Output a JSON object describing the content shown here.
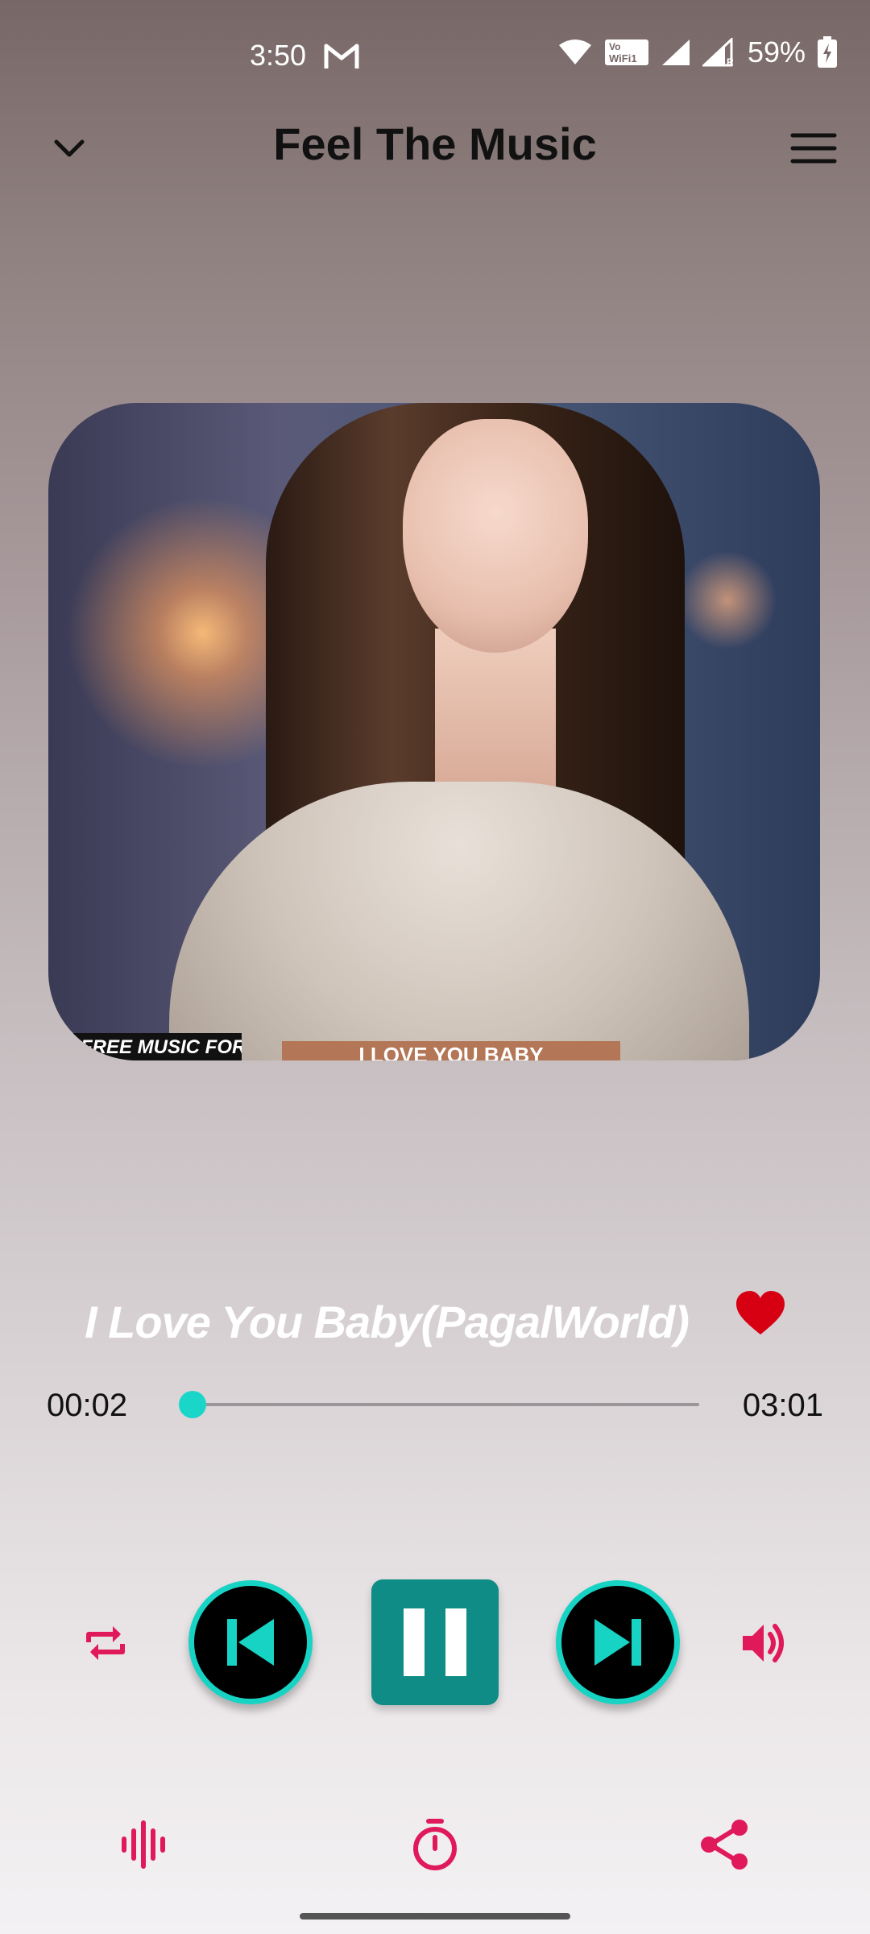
{
  "status_bar": {
    "time": "3:50",
    "battery": "59%",
    "icons": [
      "gmail-icon",
      "wifi-icon",
      "vowifi-icon",
      "signal-icon",
      "signal-r-icon",
      "battery-charging-icon"
    ]
  },
  "header": {
    "title": "Feel The Music",
    "left_icon": "chevron-down-icon",
    "right_icon": "menu-icon"
  },
  "album_art": {
    "label_left": "FREE MUSIC FOR YOU",
    "label_center": "I LOVE YOU BABY"
  },
  "track": {
    "title": "I Love You Baby(PagalWorld)",
    "favorite": true,
    "current_time": "00:02",
    "total_time": "03:01",
    "progress": 0.011
  },
  "controls": {
    "icons": [
      "repeat-icon",
      "previous-icon",
      "pause-icon",
      "next-icon",
      "volume-icon"
    ]
  },
  "bottom_bar": {
    "icons": [
      "equalizer-icon",
      "timer-icon",
      "share-icon"
    ]
  },
  "colors": {
    "accent_teal": "#17d3c4",
    "pause_bg": "#0f8c86",
    "icon_pink": "#e0195a",
    "heart_red": "#d60012"
  }
}
